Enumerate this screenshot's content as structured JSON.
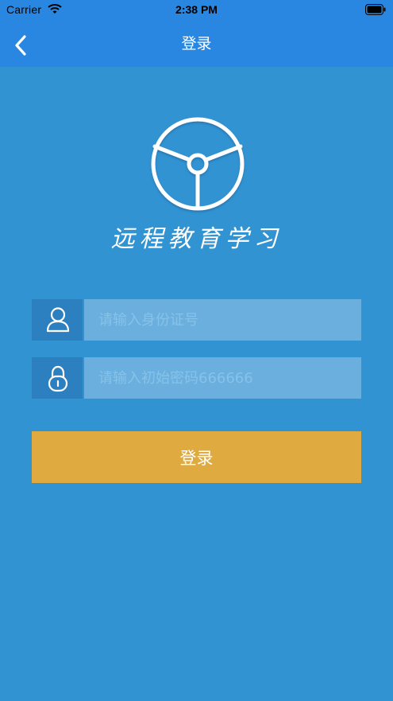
{
  "status_bar": {
    "carrier": "Carrier",
    "time": "2:38 PM",
    "wifi_icon": "wifi-icon",
    "battery_icon": "battery-icon"
  },
  "nav": {
    "title": "登录",
    "back_icon": "chevron-left-icon"
  },
  "brand": {
    "logo_icon": "steering-wheel-icon",
    "app_name": "远程教育学习"
  },
  "form": {
    "id_field": {
      "icon": "user-icon",
      "placeholder": "请输入身份证号",
      "value": ""
    },
    "password_field": {
      "icon": "lock-icon",
      "placeholder": "请输入初始密码666666",
      "value": ""
    },
    "submit_label": "登录"
  },
  "colors": {
    "header_bg": "#2a87e1",
    "page_bg": "#3193d2",
    "input_bg": "#6aafde",
    "icon_box_bg": "#2c80bf",
    "button_bg": "#dfaa3f"
  }
}
